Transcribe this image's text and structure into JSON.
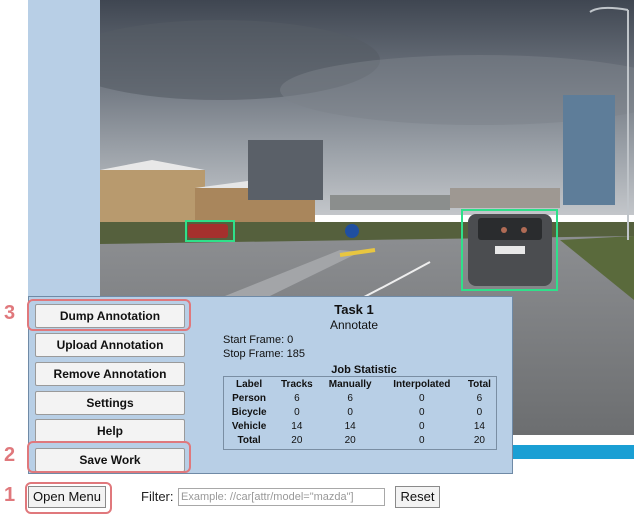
{
  "menu": {
    "buttons": [
      {
        "label": "Dump Annotation"
      },
      {
        "label": "Upload Annotation"
      },
      {
        "label": "Remove Annotation"
      },
      {
        "label": "Settings"
      },
      {
        "label": "Help"
      },
      {
        "label": "Save Work"
      }
    ]
  },
  "task": {
    "title": "Task 1",
    "mode": "Annotate",
    "start_frame": "Start Frame: 0",
    "stop_frame": "Stop Frame: 185",
    "statistic_title": "Job Statistic",
    "columns": [
      "Label",
      "Tracks",
      "Manually",
      "Interpolated",
      "Total"
    ],
    "rows": [
      [
        "Person",
        "6",
        "6",
        "0",
        "6"
      ],
      [
        "Bicycle",
        "0",
        "0",
        "0",
        "0"
      ],
      [
        "Vehicle",
        "14",
        "14",
        "0",
        "14"
      ],
      [
        "Total",
        "20",
        "20",
        "0",
        "20"
      ]
    ]
  },
  "bottom": {
    "open_menu": "Open Menu",
    "filter_label": "Filter:",
    "filter_placeholder": "Example: //car[attr/model=\"mazda\"]",
    "reset": "Reset"
  },
  "markers": [
    "1",
    "2",
    "3"
  ],
  "colors": {
    "highlight": "#e0787c",
    "bbox": "#2fe08a",
    "panel": "#b8cfe6",
    "bar": "#1a9fd4"
  }
}
